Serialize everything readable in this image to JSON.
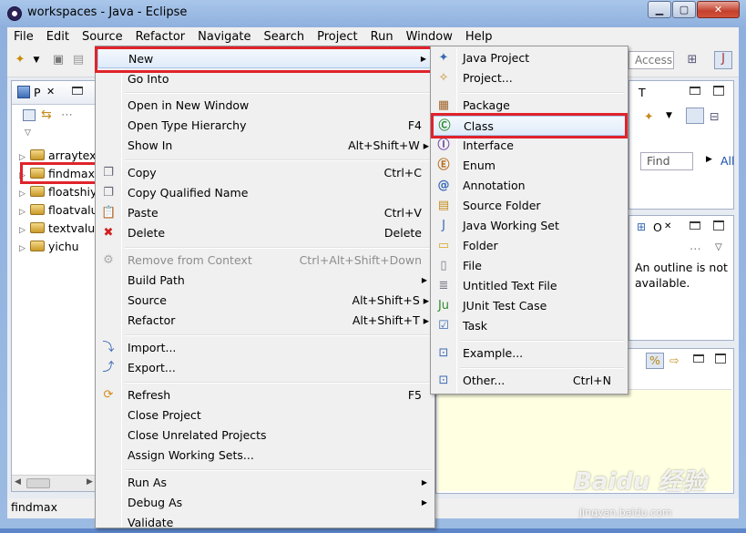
{
  "window": {
    "title": "workspaces - Java - Eclipse",
    "min_glyph": "▁",
    "max_glyph": "▢",
    "close_glyph": "✕"
  },
  "menubar": [
    "File",
    "Edit",
    "Source",
    "Refactor",
    "Navigate",
    "Search",
    "Project",
    "Run",
    "Window",
    "Help"
  ],
  "toolbar": {
    "quick_access": "Access"
  },
  "package_explorer": {
    "tab_label": "P",
    "close_glyph": "✕",
    "projects": [
      "arraytex",
      "findmax",
      "floatshiy",
      "floatvalu",
      "textvalue",
      "yichu"
    ],
    "hscroll_left": "◀",
    "hscroll_right": "▶"
  },
  "tasks_pane": {
    "tab_label": "T",
    "find_placeholder": "Find",
    "all_label": "All"
  },
  "outline_pane": {
    "tab_label": "O",
    "message": "An outline is not available."
  },
  "status_bar": {
    "text": "findmax"
  },
  "context_menu": {
    "items": [
      {
        "label": "New",
        "shortcut": "",
        "submenu": true,
        "icon": "",
        "highlighted": true
      },
      {
        "label": "Go Into",
        "shortcut": ""
      },
      {
        "label": "Open in New Window",
        "shortcut": ""
      },
      {
        "label": "Open Type Hierarchy",
        "shortcut": "F4"
      },
      {
        "label": "Show In",
        "shortcut": "Alt+Shift+W ▸"
      },
      {
        "label": "Copy",
        "shortcut": "Ctrl+C",
        "icon": "copy-icon"
      },
      {
        "label": "Copy Qualified Name",
        "shortcut": "",
        "icon": "copy-qualified-icon"
      },
      {
        "label": "Paste",
        "shortcut": "Ctrl+V",
        "icon": "paste-icon"
      },
      {
        "label": "Delete",
        "shortcut": "Delete",
        "icon": "delete-icon"
      },
      {
        "label": "Remove from Context",
        "shortcut": "Ctrl+Alt+Shift+Down",
        "disabled": true,
        "icon": "remove-context-icon"
      },
      {
        "label": "Build Path",
        "shortcut": "",
        "submenu": true
      },
      {
        "label": "Source",
        "shortcut": "Alt+Shift+S ▸"
      },
      {
        "label": "Refactor",
        "shortcut": "Alt+Shift+T ▸"
      },
      {
        "label": "Import...",
        "shortcut": "",
        "icon": "import-icon"
      },
      {
        "label": "Export...",
        "shortcut": "",
        "icon": "export-icon"
      },
      {
        "label": "Refresh",
        "shortcut": "F5",
        "icon": "refresh-icon"
      },
      {
        "label": "Close Project",
        "shortcut": ""
      },
      {
        "label": "Close Unrelated Projects",
        "shortcut": ""
      },
      {
        "label": "Assign Working Sets...",
        "shortcut": ""
      },
      {
        "label": "Run As",
        "shortcut": "",
        "submenu": true
      },
      {
        "label": "Debug As",
        "shortcut": "",
        "submenu": true
      },
      {
        "label": "Validate",
        "shortcut": ""
      }
    ]
  },
  "new_submenu": {
    "items": [
      {
        "label": "Java Project",
        "shortcut": "",
        "icon": "java-project-icon"
      },
      {
        "label": "Project...",
        "shortcut": "",
        "icon": "project-icon"
      },
      {
        "label": "Package",
        "shortcut": "",
        "icon": "package-icon"
      },
      {
        "label": "Class",
        "shortcut": "",
        "icon": "class-icon",
        "highlighted": true
      },
      {
        "label": "Interface",
        "shortcut": "",
        "icon": "interface-icon"
      },
      {
        "label": "Enum",
        "shortcut": "",
        "icon": "enum-icon"
      },
      {
        "label": "Annotation",
        "shortcut": "",
        "icon": "annotation-icon"
      },
      {
        "label": "Source Folder",
        "shortcut": "",
        "icon": "source-folder-icon"
      },
      {
        "label": "Java Working Set",
        "shortcut": "",
        "icon": "working-set-icon"
      },
      {
        "label": "Folder",
        "shortcut": "",
        "icon": "folder-icon"
      },
      {
        "label": "File",
        "shortcut": "",
        "icon": "file-icon"
      },
      {
        "label": "Untitled Text File",
        "shortcut": "",
        "icon": "text-file-icon"
      },
      {
        "label": "JUnit Test Case",
        "shortcut": "",
        "icon": "junit-icon"
      },
      {
        "label": "Task",
        "shortcut": "",
        "icon": "task-icon"
      },
      {
        "label": "Example...",
        "shortcut": "",
        "icon": "example-icon"
      },
      {
        "label": "Other...",
        "shortcut": "Ctrl+N",
        "icon": "other-icon"
      }
    ]
  },
  "watermark": {
    "logo": "Baidu 经验",
    "url": "jingyan.baidu.com"
  },
  "colors": {
    "highlight_border": "#e0232b",
    "menu_bg": "#f0f0f0",
    "title_bar": "#9cbbe3"
  }
}
